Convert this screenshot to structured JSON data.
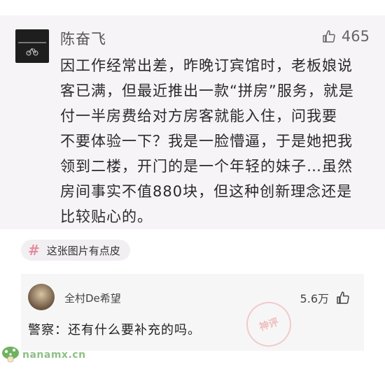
{
  "post": {
    "author": "陈奋飞",
    "likes": "465",
    "lines": [
      "因工作经常出差，昨晚订宾馆时，老板娘说",
      "客已满，但最近推出一款“拼房”服务，就是",
      "付一半房费给对方房客就能入住，问我要",
      "不要体验一下？我是一脸懵逼，于是她把我",
      "领到二楼，开门的是一个年轻的妹子…虽然",
      "房间事实不值880块，但这种创新理念还是",
      "比较贴心的。"
    ]
  },
  "tag": {
    "label": "这张图片有点皮"
  },
  "reply": {
    "author": "全村De希望",
    "likes": "5.6万",
    "text": "警察：还有什么要补充的吗。",
    "stamp_text": "神评"
  },
  "watermark": {
    "text": "nanamx.cn"
  },
  "colors": {
    "card_bg": "#f7f4f7",
    "hash_accent": "#e58ca0",
    "watermark": "#8fbf86"
  },
  "icons": {
    "like": "thumbs-up-icon",
    "hash": "hash-icon"
  }
}
